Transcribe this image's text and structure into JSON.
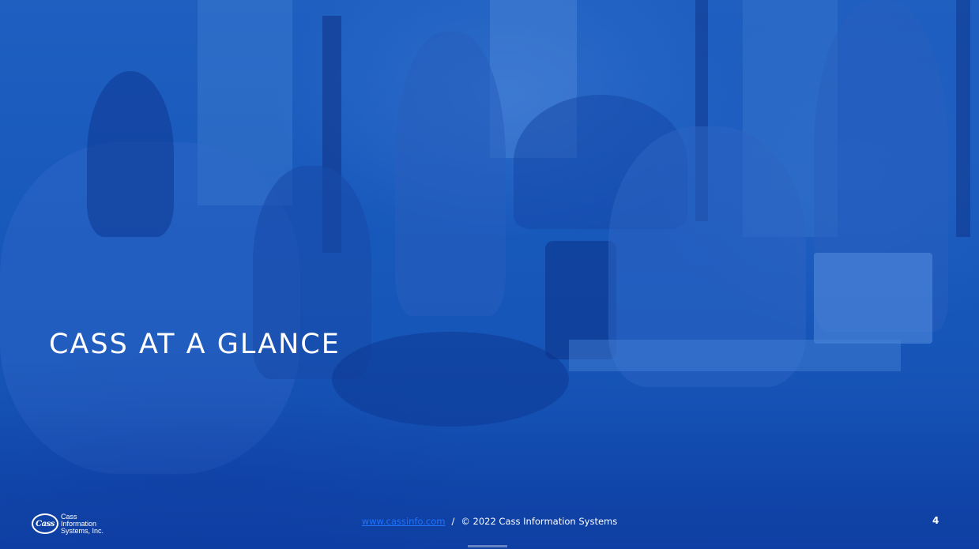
{
  "slide": {
    "title": "CASS AT A GLANCE",
    "page_number": "4",
    "accent_color": "#1556b8",
    "link_color": "#1f73ff"
  },
  "footer": {
    "link_text": "www.cassinfo.com",
    "separator": "/",
    "copyright": "© 2022 Cass Information Systems"
  },
  "logo": {
    "mark": "Cass",
    "line1": "Cass",
    "line2": "Information",
    "line3": "Systems, Inc."
  }
}
